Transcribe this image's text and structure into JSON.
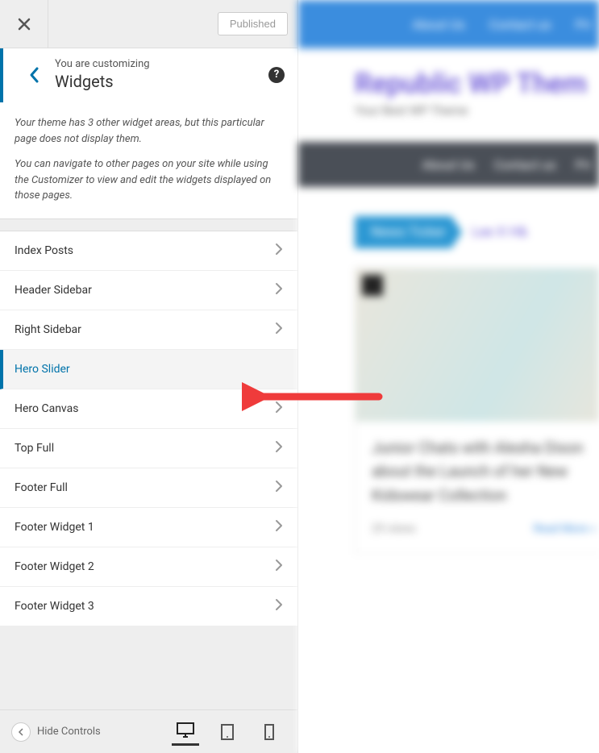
{
  "topbar": {
    "published_label": "Published"
  },
  "heading": {
    "subtitle": "You are customizing",
    "title": "Widgets",
    "help_glyph": "?"
  },
  "description": {
    "p1": "Your theme has 3 other widget areas, but this particular page does not display them.",
    "p2": "You can navigate to other pages on your site while using the Customizer to view and edit the widgets displayed on those pages."
  },
  "widget_areas": [
    {
      "label": "Index Posts",
      "active": false
    },
    {
      "label": "Header Sidebar",
      "active": false
    },
    {
      "label": "Right Sidebar",
      "active": false
    },
    {
      "label": "Hero Slider",
      "active": true
    },
    {
      "label": "Hero Canvas",
      "active": false
    },
    {
      "label": "Top Full",
      "active": false
    },
    {
      "label": "Footer Full",
      "active": false
    },
    {
      "label": "Footer Widget 1",
      "active": false
    },
    {
      "label": "Footer Widget 2",
      "active": false
    },
    {
      "label": "Footer Widget 3",
      "active": false
    }
  ],
  "bottom_bar": {
    "hide_controls_label": "Hide Controls"
  },
  "preview": {
    "top_nav": [
      "About Us",
      "Contact us",
      "Pri"
    ],
    "site_title": "Republic WP Them",
    "site_tagline": "Your Best WP Theme",
    "menu": [
      "About Us",
      "Contact us",
      "Pri"
    ],
    "ticker_label": "News Ticker",
    "ticker_text": "Lee X H&",
    "post_title": "Junior Chats with Alesha Dixon about the Launch of her New Kidswear Collection",
    "views_label": "29 views",
    "read_more": "Read More »"
  }
}
